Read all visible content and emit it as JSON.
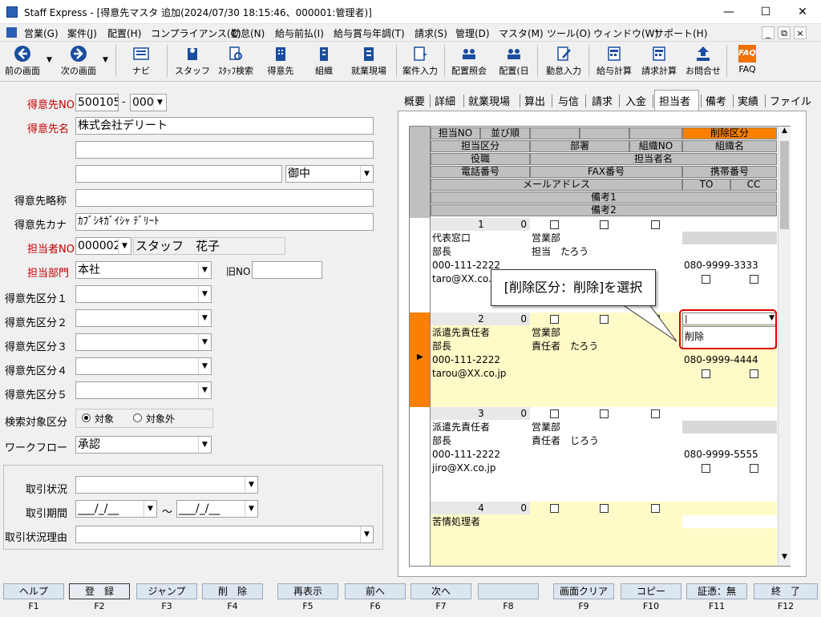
{
  "window": {
    "title": "Staff Express - [得意先マスタ 追加(2024/07/30 18:15:46、000001:管理者)]",
    "min": "—",
    "max": "☐",
    "close": "✕"
  },
  "menu": [
    "営業(G)",
    "案件(J)",
    "配置(H)",
    "コンプライアンス(C)",
    "勤怠(N)",
    "給与前払(I)",
    "給与賞与年調(T)",
    "請求(S)",
    "管理(D)",
    "マスタ(M)",
    "ツール(O)",
    "ウィンドウ(W)",
    "サポート(H)"
  ],
  "mdi": {
    "min": "_",
    "restore": "⧉",
    "close": "×"
  },
  "toolbar": [
    "前の画面",
    "次の画面",
    "ナビ",
    "スタッフ",
    "ｽﾀｯﾌ検索",
    "得意先",
    "組織",
    "就業現場",
    "案件入力",
    "配置照会",
    "配置(日",
    "勤怠入力",
    "給与計算",
    "請求計算",
    "お問合せ",
    "FAQ"
  ],
  "form": {
    "no_label": "得意先NO",
    "no_value": "500105",
    "no_sep": "-",
    "no_sub": "000",
    "name_label": "得意先名",
    "name_value": "株式会社デリート",
    "name2": "",
    "name3": "",
    "honorific": "御中",
    "short_label": "得意先略称",
    "short_value": "",
    "kana_label": "得意先カナ",
    "kana_value": "ｶﾌﾞｼｷｶﾞｲｼｬ ﾃﾞﾘｰﾄ",
    "staff_label": "担当者NO",
    "staff_no": "000002",
    "staff_name": "スタッフ　花子",
    "dept_label": "担当部門",
    "dept_value": "本社",
    "old_no_label": "旧NO",
    "old_no_value": "",
    "class1": "得意先区分１",
    "class2": "得意先区分２",
    "class3": "得意先区分３",
    "class4": "得意先区分４",
    "class5": "得意先区分５",
    "search_label": "検索対象区分",
    "radio_on": "対象",
    "radio_off": "対象外",
    "workflow_label": "ワークフロー",
    "workflow_value": "承認",
    "deal_status_label": "取引状況",
    "deal_period_label": "取引期間",
    "deal_period_from": "___/_/__",
    "deal_period_to": "___/_/__",
    "tilde": "～",
    "deal_reason_label": "取引状況理由"
  },
  "tabs": [
    "概要",
    "詳細",
    "就業現場",
    "算出",
    "与信",
    "請求",
    "入金",
    "担当者",
    "備考",
    "実績",
    "ファイル"
  ],
  "active_tab": "担当者",
  "grid_header": {
    "r1": [
      "担当NO",
      "並び順",
      "",
      "",
      "",
      "削除区分"
    ],
    "r2": [
      "担当区分",
      "部署",
      "組織NO",
      "組織名"
    ],
    "r3": [
      "役職",
      "担当者名"
    ],
    "r4": [
      "電話番号",
      "FAX番号",
      "携帯番号"
    ],
    "r5": [
      "メールアドレス",
      "TO",
      "CC"
    ],
    "r6": "備考1",
    "r7": "備考2"
  },
  "records": [
    {
      "no": "1",
      "order": "0",
      "kubun": "代表窓口",
      "dept": "営業部",
      "title": "部長",
      "person": "担当　たろう",
      "tel": "000-111-2222",
      "fax": "",
      "mobile": "080-9999-3333",
      "mail": "taro@XX.co.jp"
    },
    {
      "no": "2",
      "order": "0",
      "kubun": "派遣先責任者",
      "dept": "営業部",
      "title": "部長",
      "person": "責任者　たろう",
      "tel": "000-111-2222",
      "fax": "",
      "mobile": "080-9999-4444",
      "mail": "tarou@XX.co.jp"
    },
    {
      "no": "3",
      "order": "0",
      "kubun": "派遣先責任者",
      "dept": "営業部",
      "title": "部長",
      "person": "責任者　じろう",
      "tel": "000-111-2222",
      "fax": "",
      "mobile": "080-9999-5555",
      "mail": "jiro@XX.co.jp"
    },
    {
      "no": "4",
      "order": "0",
      "kubun": "苦情処理者",
      "dept": "",
      "title": "",
      "person": "",
      "tel": "",
      "fax": "",
      "mobile": "",
      "mail": ""
    }
  ],
  "dropdown_option": "削除",
  "callout": "[削除区分：削除]を選択",
  "fkeys": [
    {
      "label": "ヘルプ",
      "key": "F1"
    },
    {
      "label": "登　録",
      "key": "F2"
    },
    {
      "label": "ジャンプ",
      "key": "F3"
    },
    {
      "label": "削　除",
      "key": "F4"
    },
    {
      "label": "再表示",
      "key": "F5"
    },
    {
      "label": "前へ",
      "key": "F6"
    },
    {
      "label": "次へ",
      "key": "F7"
    },
    {
      "label": "",
      "key": "F8"
    },
    {
      "label": "画面クリア",
      "key": "F9"
    },
    {
      "label": "コピー",
      "key": "F10"
    },
    {
      "label": "証憑：無",
      "key": "F11"
    },
    {
      "label": "終　了",
      "key": "F12"
    }
  ],
  "colors": {
    "accent": "#f98000",
    "required": "#c00000",
    "row_selected": "#fffbc8",
    "fkey": "#dce6f0",
    "callout_border": "#e00000"
  }
}
